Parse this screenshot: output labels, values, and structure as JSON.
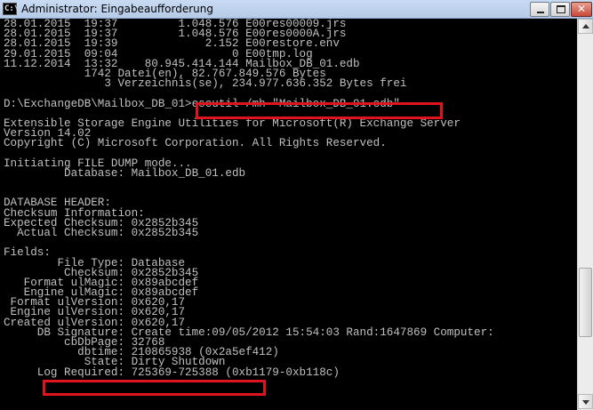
{
  "window": {
    "title": "Administrator: Eingabeaufforderung",
    "icon_label": "C:\\",
    "close_glyph": "✕"
  },
  "console": {
    "lines": [
      "28.01.2015  19:37         1.048.576 E00res00009.jrs",
      "28.01.2015  19:37         1.048.576 E00res0000A.jrs",
      "28.01.2015  19:39             2.152 E00restore.env",
      "29.01.2015  09:04                 0 E00tmp.log",
      "11.12.2014  13:32    80.945.414.144 Mailbox_DB_01.edb",
      "            1742 Datei(en), 82.767.849.576 Bytes",
      "               3 Verzeichnis(se), 234.977.636.352 Bytes frei",
      "",
      "D:\\ExchangeDB\\Mailbox_DB_01>eseutil /mh \"Mailbox_DB_01.edb\"",
      "",
      "Extensible Storage Engine Utilities for Microsoft(R) Exchange Server",
      "Version 14.02",
      "Copyright (C) Microsoft Corporation. All Rights Reserved.",
      "",
      "Initiating FILE DUMP mode...",
      "         Database: Mailbox_DB_01.edb",
      "",
      "",
      "DATABASE HEADER:",
      "Checksum Information:",
      "Expected Checksum: 0x2852b345",
      "  Actual Checksum: 0x2852b345",
      "",
      "Fields:",
      "        File Type: Database",
      "         Checksum: 0x2852b345",
      "   Format ulMagic: 0x89abcdef",
      "   Engine ulMagic: 0x89abcdef",
      " Format ulVersion: 0x620,17",
      " Engine ulVersion: 0x620,17",
      "Created ulVersion: 0x620,17",
      "     DB Signature: Create time:09/05/2012 15:54:03 Rand:1647869 Computer:",
      "         cbDbPage: 32768",
      "           dbtime: 210865938 (0x2a5ef412)",
      "            State: Dirty Shutdown",
      "     Log Required: 725369-725388 (0xb1179-0xb118c)"
    ]
  },
  "colors": {
    "console_text": "#c0c0c0",
    "console_bg": "#000000",
    "highlight": "#e0141e"
  }
}
